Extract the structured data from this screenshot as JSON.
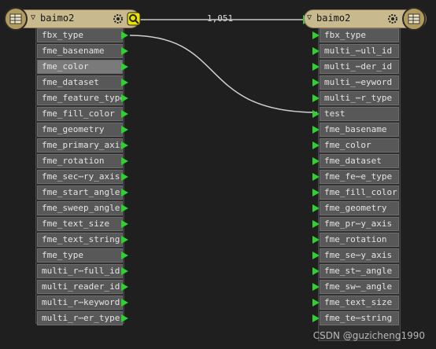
{
  "source_node": {
    "title": "baimo2",
    "attributes": [
      "fbx_type",
      "fme_basename",
      "fme_color",
      "fme_dataset",
      "fme_feature_type",
      "fme_fill_color",
      "fme_geometry",
      "fme_primary_axis",
      "fme_rotation",
      "fme_sec⋯ry_axis",
      "fme_start_angle",
      "fme_sweep_angle",
      "fme_text_size",
      "fme_text_string",
      "fme_type",
      "multi_r⋯full_id",
      "multi_reader_id",
      "multi_r⋯keyword",
      "multi_r⋯er_type"
    ]
  },
  "target_node": {
    "title": "baimo2",
    "attributes": [
      "fbx_type",
      "multi_⋯ull_id",
      "multi_⋯der_id",
      "multi_⋯eyword",
      "multi_⋯r_type",
      "test",
      "fme_basename",
      "fme_color",
      "fme_dataset",
      "fme_fe⋯e_type",
      "fme_fill_color",
      "fme_geometry",
      "fme_pr⋯y_axis",
      "fme_rotation",
      "fme_se⋯y_axis",
      "fme_st⋯_angle",
      "fme_sw⋯_angle",
      "fme_text_size",
      "fme_te⋯string"
    ]
  },
  "connection": {
    "label": "1,051"
  },
  "watermark": "CSDN @guzicheng1990",
  "colors": {
    "port": "#2fd12f",
    "header": "#c9b98f",
    "link": "#d0d0d0"
  }
}
